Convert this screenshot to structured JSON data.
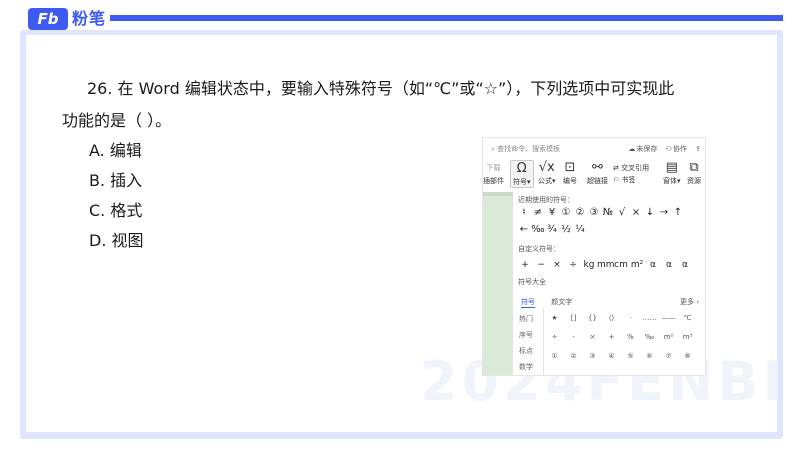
{
  "brand": {
    "mark": "Fb",
    "name": "粉笔"
  },
  "question": {
    "line1": "26. 在 Word 编辑状态中，要输入特殊符号（如“℃”或“☆”），下列选项中可实现此",
    "line2": "功能的是（ ）。"
  },
  "options": [
    {
      "label": "A. 编辑"
    },
    {
      "label": "B. 插入"
    },
    {
      "label": "C. 格式"
    },
    {
      "label": "D. 视图"
    }
  ],
  "watermark": "2024FENBI",
  "screenshot": {
    "search_placeholder": "查找命令、搜索模板",
    "status_unsaved": "未保存",
    "status_collab": "协作",
    "ribbon": {
      "left_partial_top": "下载",
      "left_partial_bottom": "插部件",
      "symbol": "符号",
      "formula": "公式",
      "numbering": "编号",
      "hyperlink": "超链接",
      "crossref": "交叉引用",
      "bookmark": "书签",
      "window": "窗体",
      "resources": "资源"
    },
    "recent_label": "近期使用的符号：",
    "recent_row1": [
      "♮",
      "≠",
      "¥",
      "①",
      "②",
      "③",
      "№",
      "√",
      "×",
      "↓",
      "→",
      "↑"
    ],
    "recent_row2": [
      "←",
      "‰",
      "¾",
      "½",
      "¼"
    ],
    "custom_label": "自定义符号：",
    "custom_row": [
      "+",
      "−",
      "×",
      "÷",
      "kg",
      "mm",
      "cm",
      "m²",
      "α",
      "α",
      "α"
    ],
    "all_label": "符号大全",
    "tabs": {
      "symbol": "符号",
      "emoji": "颜文字"
    },
    "more": "更多 ›",
    "categories": [
      "热门",
      "序号",
      "标点",
      "数学"
    ],
    "grid_row1": [
      "★",
      "[]",
      "{}",
      "⟨⟩",
      "·",
      "……",
      "——",
      "℃"
    ],
    "grid_row2": [
      "÷",
      "-",
      "×",
      "+",
      "%",
      "‰",
      "m²",
      "m³"
    ],
    "grid_row3": [
      "①",
      "②",
      "③",
      "④",
      "⑤",
      "⑥",
      "⑦",
      "⑧"
    ]
  },
  "colors": {
    "accent": "#3d5af1",
    "frame": "#dfe4ff",
    "green_panel": "#dbe9d8"
  }
}
